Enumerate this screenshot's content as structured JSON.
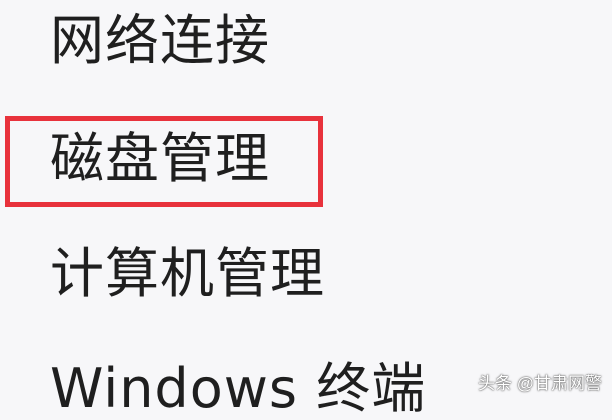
{
  "menu": {
    "items": [
      {
        "label": "网络连接"
      },
      {
        "label": "磁盘管理"
      },
      {
        "label": "计算机管理"
      },
      {
        "label": "Windows 终端"
      }
    ]
  },
  "highlight": {
    "target": "磁盘管理",
    "color": "#e8323c"
  },
  "watermark": {
    "text": "头条 @甘肃网警"
  }
}
